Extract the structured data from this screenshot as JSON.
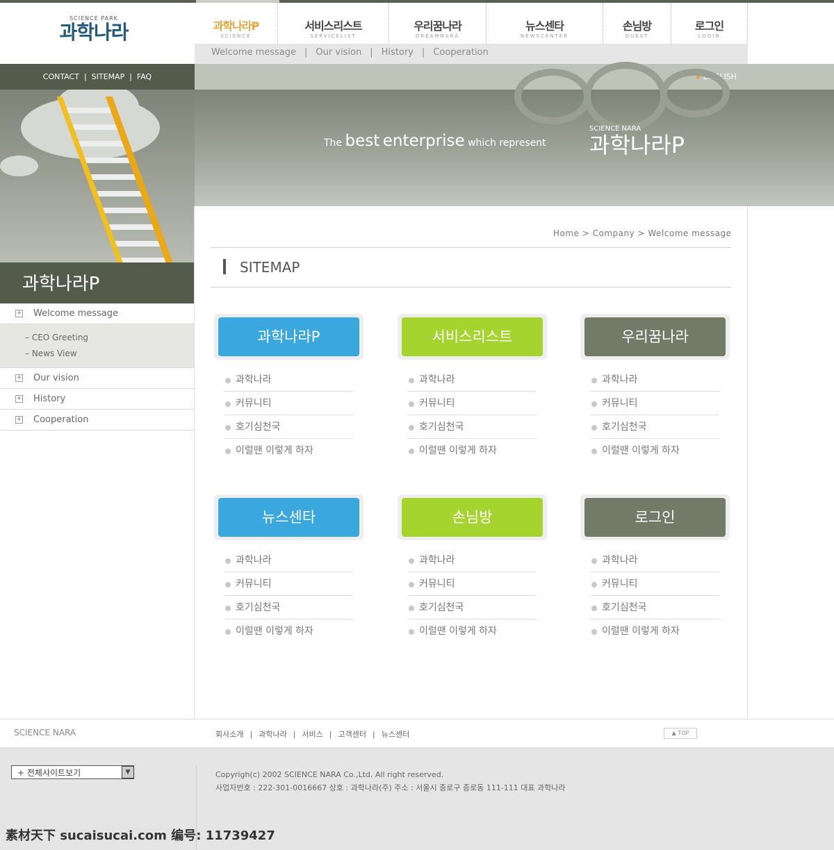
{
  "colors": {
    "blue": "#3aa8df",
    "green": "#a6d42e",
    "gray": "#737a68",
    "dark": "#555b4b",
    "accent": "#e7a43a"
  },
  "logo": {
    "small": "SCIENCE PARK",
    "main": "과학나라"
  },
  "gnb": [
    {
      "ko": "과학나라P",
      "en": "SCIENCE",
      "active": true
    },
    {
      "ko": "서비스리스트",
      "en": "SERVICELIST"
    },
    {
      "ko": "우리꿈나라",
      "en": "DREAMNARA"
    },
    {
      "ko": "뉴스센타",
      "en": "NEWSCENTER"
    },
    {
      "ko": "손님방",
      "en": "GUEST"
    },
    {
      "ko": "로그인",
      "en": "LOGIN"
    }
  ],
  "subnav": [
    "Welcome message",
    "Our vision",
    "History",
    "Cooperation"
  ],
  "util": [
    "CONTACT",
    "SITEMAP",
    "FAQ"
  ],
  "english": "ENGLISH",
  "banner": {
    "the": "The",
    "best": "best",
    "enterprise": "enterprise",
    "which": "which represent",
    "brand_small": "SCIENCE NARA",
    "brand": "과학나라P"
  },
  "left": {
    "title": "과학나라P",
    "items": [
      {
        "label": "Welcome message",
        "sub": [
          "CEO Greeting",
          "News View"
        ]
      },
      {
        "label": "Our vision"
      },
      {
        "label": "History"
      },
      {
        "label": "Cooperation"
      }
    ]
  },
  "breadcrumb": "Home > Company > Welcome message",
  "section_title": "SITEMAP",
  "cards": [
    {
      "title": "과학나라P",
      "color": "blue",
      "items": [
        "과학나라",
        "커뮤니티",
        "호기심천국",
        "이럴땐 이렇게 하자"
      ]
    },
    {
      "title": "서비스리스트",
      "color": "green",
      "items": [
        "과학나라",
        "커뮤니티",
        "호기심천국",
        "이럴땐 이렇게 하자"
      ]
    },
    {
      "title": "우리꿈나라",
      "color": "gray",
      "items": [
        "과학나라",
        "커뮤니티",
        "호기심천국",
        "이럴땐 이렇게 하자"
      ]
    },
    {
      "title": "뉴스센타",
      "color": "blue",
      "items": [
        "과학나라",
        "커뮤니티",
        "호기심천국",
        "이럴땐 이렇게 하자"
      ]
    },
    {
      "title": "손님방",
      "color": "green",
      "items": [
        "과학나라",
        "커뮤니티",
        "호기심천국",
        "이럴땐 이렇게 하자"
      ]
    },
    {
      "title": "로그인",
      "color": "gray",
      "items": [
        "과학나라",
        "커뮤니티",
        "호기심천국",
        "이럴땐 이렇게 하자"
      ]
    }
  ],
  "footer": {
    "brand": "SCIENCE NARA",
    "links": [
      "회사소개",
      "과학나라",
      "서비스",
      "고객센터",
      "뉴스센터"
    ],
    "top": "▲ TOP",
    "select": "+ 전체사이트보기",
    "copyright": "Copyrigh(c) 2002 SCIENCE NARA Co.,Ltd. All right reserved.",
    "info": "사업자번호 : 222-301-0016667 상호 : 과학나라(주)  주소 : 서울시 종로구 종로동 111-111 대표 과학나라",
    "watermark": "素材天下 sucaisucai.com  编号: 11739427"
  }
}
